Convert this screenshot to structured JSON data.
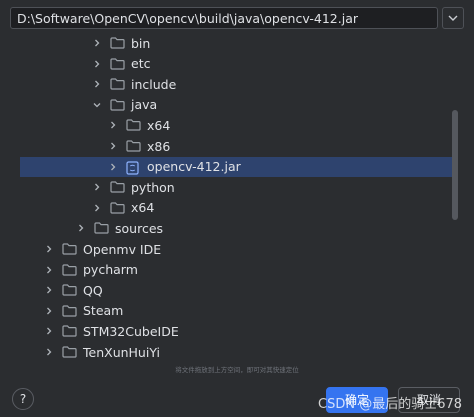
{
  "path": {
    "value": "D:\\Software\\OpenCV\\opencv\\build\\java\\opencv-412.jar"
  },
  "tree": [
    {
      "label": "bin",
      "type": "folder",
      "indent": 4,
      "expanded": false
    },
    {
      "label": "etc",
      "type": "folder",
      "indent": 4,
      "expanded": false
    },
    {
      "label": "include",
      "type": "folder",
      "indent": 4,
      "expanded": false
    },
    {
      "label": "java",
      "type": "folder",
      "indent": 4,
      "expanded": true
    },
    {
      "label": "x64",
      "type": "folder",
      "indent": 5,
      "expanded": false
    },
    {
      "label": "x86",
      "type": "folder",
      "indent": 5,
      "expanded": false
    },
    {
      "label": "opencv-412.jar",
      "type": "jar",
      "indent": 5,
      "expanded": false,
      "selected": true
    },
    {
      "label": "python",
      "type": "folder",
      "indent": 4,
      "expanded": false
    },
    {
      "label": "x64",
      "type": "folder",
      "indent": 4,
      "expanded": false
    },
    {
      "label": "sources",
      "type": "folder",
      "indent": 3,
      "expanded": false
    },
    {
      "label": "Openmv IDE",
      "type": "folder",
      "indent": 1,
      "expanded": false
    },
    {
      "label": "pycharm",
      "type": "folder",
      "indent": 1,
      "expanded": false
    },
    {
      "label": "QQ",
      "type": "folder",
      "indent": 1,
      "expanded": false
    },
    {
      "label": "Steam",
      "type": "folder",
      "indent": 1,
      "expanded": false
    },
    {
      "label": "STM32CubeIDE",
      "type": "folder",
      "indent": 1,
      "expanded": false
    },
    {
      "label": "TenXunHuiYi",
      "type": "folder",
      "indent": 1,
      "expanded": false
    }
  ],
  "hint": "将文件拖放到上方空间，即可对其快速定位",
  "buttons": {
    "ok": "确定",
    "cancel": "取消",
    "help": "?"
  },
  "watermark": "CSDN @最后的骑士678",
  "colors": {
    "accent": "#3574f0",
    "selection": "#2e436e",
    "folder": "#9aa0a6",
    "background": "#2b2d30"
  }
}
